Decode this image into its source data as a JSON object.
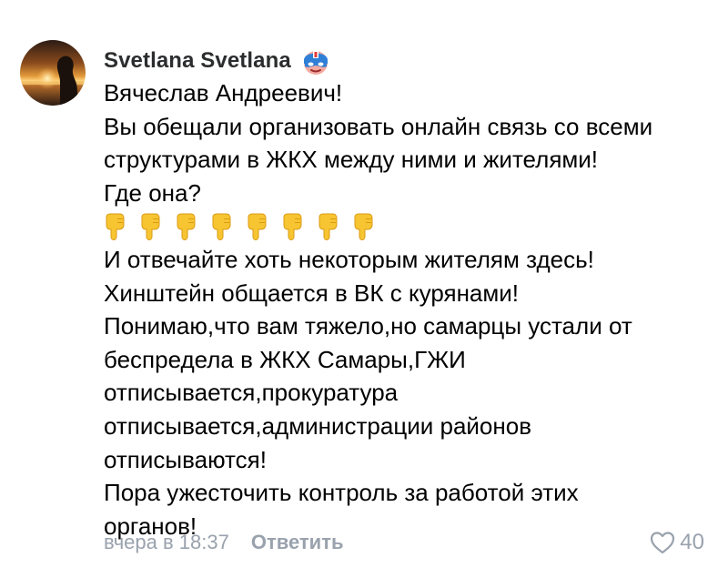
{
  "comment": {
    "author": "Svetlana Svetlana",
    "badge_icon": "superhero-mask-icon",
    "text_lines_before_emoji": [
      "Вячеслав Андреевич!",
      "Вы обещали организовать онлайн связь со всеми",
      "структурами в ЖКХ между ними и жителями!",
      "Где она?"
    ],
    "emoji_icon": "pointing-down-hand-icon",
    "emoji_count": 8,
    "text_lines_after_emoji": [
      "И отвечайте хоть некоторым жителям здесь!",
      "Хинштейн общается в ВК с курянами!",
      "Понимаю,что вам тяжело,но самарцы устали от",
      "беспредела в ЖКХ Самары,ГЖИ",
      "отписывается,прокуратура",
      "отписывается,администрации районов",
      "отписываются!",
      "Пора ужесточить контроль за работой этих",
      "органов!"
    ],
    "timestamp": "вчера в 18:37",
    "reply_label": "Ответить",
    "like_icon": "heart-icon",
    "like_count": "40"
  },
  "colors": {
    "secondary_text": "#99a2ad",
    "author_text": "#2c2d2e",
    "emoji_yellow": "#f7c531"
  }
}
